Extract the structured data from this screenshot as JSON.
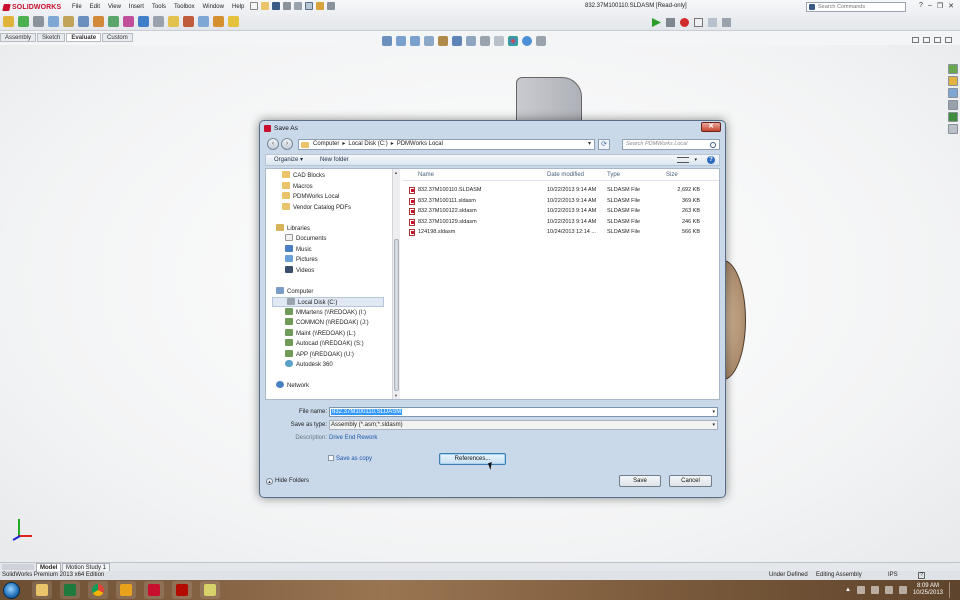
{
  "app": {
    "logo_text": "SOLIDWORKS",
    "window_title": "832.37M100110.SLDASM [Read-only]",
    "search_placeholder": "Search Commands",
    "menus": [
      "File",
      "Edit",
      "View",
      "Insert",
      "Tools",
      "Toolbox",
      "Window",
      "Help"
    ],
    "command_tabs": [
      {
        "label": "Assembly",
        "active": false
      },
      {
        "label": "Sketch",
        "active": false
      },
      {
        "label": "Evaluate",
        "active": true
      },
      {
        "label": "Custom",
        "active": false
      }
    ],
    "model_tabs": [
      {
        "label": "Model",
        "active": true
      },
      {
        "label": "Motion Study 1",
        "active": false
      }
    ],
    "status": {
      "product": "SolidWorks Premium 2013 x64 Edition",
      "definition": "Under Defined",
      "mode": "Editing Assembly",
      "units": "IPS",
      "help": "?"
    }
  },
  "dialog": {
    "title": "Save As",
    "close_label": "✕",
    "breadcrumbs": [
      "Computer",
      "▸",
      "Local Disk (C:)",
      "▸",
      "PDMWorks Local"
    ],
    "search_placeholder": "Search PDMWorks Local",
    "toolbar": {
      "organize": "Organize ▾",
      "new_folder": "New folder",
      "help": "?"
    },
    "nav_items": [
      {
        "label": "CAD Blocks",
        "kind": "folder"
      },
      {
        "label": "Macros",
        "kind": "folder"
      },
      {
        "label": "PDMWorks Local",
        "kind": "folder"
      },
      {
        "label": "Vendor Catalog PDFs",
        "kind": "folder"
      },
      {
        "label": "Libraries",
        "kind": "library"
      },
      {
        "label": "Documents",
        "kind": "doc"
      },
      {
        "label": "Music",
        "kind": "music"
      },
      {
        "label": "Pictures",
        "kind": "pic"
      },
      {
        "label": "Videos",
        "kind": "video"
      },
      {
        "label": "Computer",
        "kind": "computer"
      },
      {
        "label": "Local Disk (C:)",
        "kind": "disk",
        "selected": true
      },
      {
        "label": "MMartens (\\\\REDOAK) (I:)",
        "kind": "net"
      },
      {
        "label": "COMMON (\\\\REDOAK) (J:)",
        "kind": "net"
      },
      {
        "label": "Maint (\\\\REDOAK) (L:)",
        "kind": "net"
      },
      {
        "label": "Autocad (\\\\REDOAK) (S:)",
        "kind": "net"
      },
      {
        "label": "APP (\\\\REDOAK) (U:)",
        "kind": "net"
      },
      {
        "label": "Autodesk 360",
        "kind": "cloud"
      },
      {
        "label": "Network",
        "kind": "network"
      }
    ],
    "columns": {
      "name": "Name",
      "date": "Date modified",
      "type": "Type",
      "size": "Size"
    },
    "files": [
      {
        "name": "832.37M100110.SLDASM",
        "date": "10/22/2013 9:14 AM",
        "type": "SLDASM File",
        "size": "2,692 KB"
      },
      {
        "name": "832.37M100111.sldasm",
        "date": "10/22/2013 9:14 AM",
        "type": "SLDASM File",
        "size": "369 KB"
      },
      {
        "name": "832.37M100122.sldasm",
        "date": "10/22/2013 9:14 AM",
        "type": "SLDASM File",
        "size": "263 KB"
      },
      {
        "name": "832.37M100129.sldasm",
        "date": "10/22/2013 9:14 AM",
        "type": "SLDASM File",
        "size": "246 KB"
      },
      {
        "name": "124198.sldasm",
        "date": "10/24/2013 12:14 ...",
        "type": "SLDASM File",
        "size": "566 KB"
      }
    ],
    "file_name_label": "File name:",
    "file_name_value": "832.37M100110.SLDASM",
    "save_type_label": "Save as type:",
    "save_type_value": "Assembly (*.asm;*.sldasm)",
    "description_label": "Description:",
    "description_value": "Drive End Rework",
    "save_as_copy_label": "Save as copy",
    "references_label": "References...",
    "hide_folders_label": "Hide Folders",
    "save_label": "Save",
    "cancel_label": "Cancel"
  },
  "taskbar": {
    "time": "8:09 AM",
    "date": "10/25/2013"
  },
  "colors": {
    "brand_red": "#c8102e",
    "selection_blue": "#3399ff",
    "link_blue": "#1b56a8"
  }
}
